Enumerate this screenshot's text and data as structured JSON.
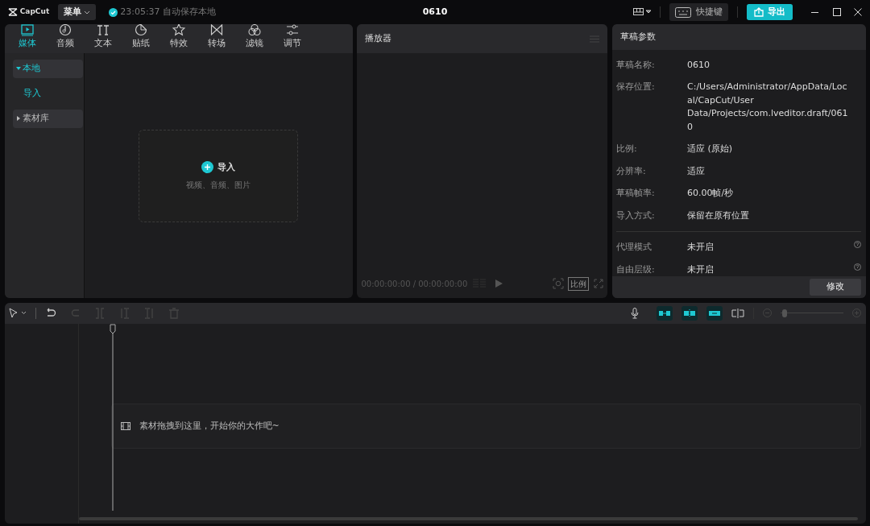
{
  "app": {
    "logo": "CapCut",
    "menu": "菜单",
    "autosave": "23:05:37 自动保存本地",
    "title": "0610",
    "shortcuts": "快捷键",
    "export": "导出"
  },
  "media_tabs": [
    {
      "label": "媒体",
      "kind": "media",
      "selected": true
    },
    {
      "label": "音频",
      "kind": "audio",
      "selected": false
    },
    {
      "label": "文本",
      "kind": "text",
      "selected": false
    },
    {
      "label": "贴纸",
      "kind": "sticker",
      "selected": false
    },
    {
      "label": "特效",
      "kind": "effect",
      "selected": false
    },
    {
      "label": "转场",
      "kind": "transition",
      "selected": false
    },
    {
      "label": "滤镜",
      "kind": "filter",
      "selected": false
    },
    {
      "label": "调节",
      "kind": "adjust",
      "selected": false
    }
  ],
  "library": [
    {
      "label": "本地",
      "selected": true,
      "expanded": true,
      "children": [
        {
          "label": "导入",
          "selected": true
        }
      ]
    },
    {
      "label": "素材库",
      "selected": false,
      "expanded": false
    }
  ],
  "import_box": {
    "title": "导入",
    "hint": "视频、音频、图片"
  },
  "player": {
    "title": "播放器",
    "timecode": "00:00:00:00 / 00:00:00:00",
    "ratio": "比例"
  },
  "draft": {
    "title": "草稿参数",
    "rows": [
      {
        "label": "草稿名称:",
        "value": "0610"
      },
      {
        "label": "保存位置:",
        "value": "C:/Users/Administrator/AppData/Local/CapCut/User Data/Projects/com.lveditor.draft/0610"
      },
      {
        "label": "比例:",
        "value": "适应 (原始)"
      },
      {
        "label": "分辨率:",
        "value": "适应"
      },
      {
        "label": "草稿帧率:",
        "value": "60.00帧/秒"
      },
      {
        "label": "导入方式:",
        "value": "保留在原有位置"
      }
    ],
    "settings": [
      {
        "label": "代理模式",
        "value": "未开启"
      },
      {
        "label": "自由层级:",
        "value": "未开启"
      }
    ],
    "edit_button": "修改"
  },
  "timeline": {
    "tools": [
      {
        "kind": "undo",
        "disabled": false
      },
      {
        "kind": "redo",
        "disabled": true
      },
      {
        "kind": "split",
        "disabled": true
      },
      {
        "kind": "trim-left",
        "disabled": true
      },
      {
        "kind": "trim-right",
        "disabled": true
      },
      {
        "kind": "delete",
        "disabled": true
      }
    ],
    "hint": "素材拖拽到这里，开始你的大作吧~",
    "zoom": {
      "level": 0.03
    }
  }
}
